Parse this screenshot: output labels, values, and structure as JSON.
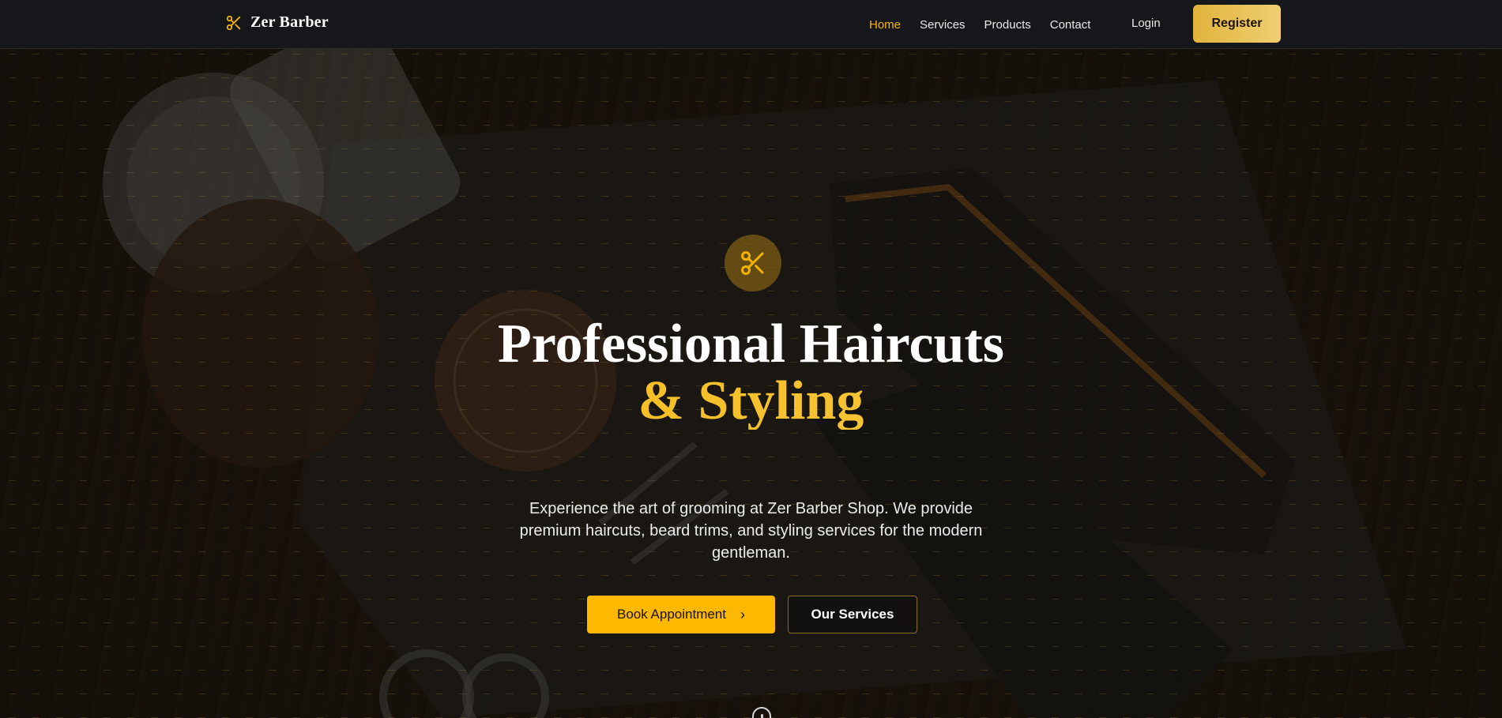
{
  "brand": {
    "name": "Zer Barber",
    "icon": "scissors-icon"
  },
  "nav": {
    "links": [
      {
        "label": "Home",
        "active": true
      },
      {
        "label": "Services",
        "active": false
      },
      {
        "label": "Products",
        "active": false
      },
      {
        "label": "Contact",
        "active": false
      }
    ],
    "login_label": "Login",
    "register_label": "Register"
  },
  "hero": {
    "badge_icon": "scissors-icon",
    "title_line1": "Professional Haircuts",
    "title_line2": "& Styling",
    "description": "Experience the art of grooming at Zer Barber Shop. We provide premium haircuts, beard trims, and styling services for the modern gentleman.",
    "primary_button": "Book Appointment",
    "primary_button_icon": "chevron-right-icon",
    "secondary_button": "Our Services",
    "scroll_icon": "mouse-scroll-icon"
  },
  "colors": {
    "accent": "#f5b300",
    "nav_bg": "#15171b",
    "register_gradient_start": "#e0b33c",
    "register_gradient_end": "#f0cf72"
  }
}
